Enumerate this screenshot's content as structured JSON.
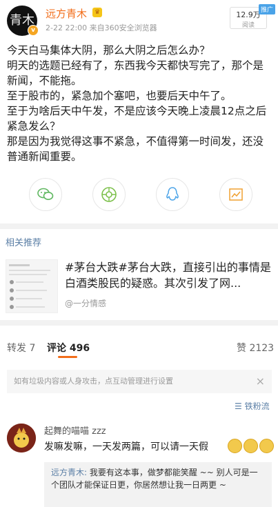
{
  "header": {
    "username": "远方青木",
    "avatar_text": "青木",
    "meta": "2-22 22:00 来自360安全浏览器",
    "read_count": "12.9万",
    "read_label": "阅读",
    "promo_label": "推广"
  },
  "post": {
    "paragraphs": [
      "今天白马集体大阴，那么大阴之后怎么办？",
      "明天的选题已经有了，东西我今天都快写完了，那个是新闻，不能拖。",
      "至于股市的，紧急加个塞吧，也要后天中午了。",
      "至于为啥后天中午发，不是应该今天晚上凌晨12点之后紧急发么？",
      "那是因为我觉得这事不紧急，不值得第一时间发，还没普通新闻重要。"
    ]
  },
  "share": {
    "icons": [
      "wechat-icon",
      "moments-icon",
      "qq-icon",
      "chart-icon"
    ]
  },
  "related": {
    "title": "相关推荐",
    "text": "#茅台大跌#茅台大跌，直接引出的事情是白酒类股民的疑惑。其次引发了网...",
    "source": "@一分情感"
  },
  "tabs": {
    "repost": "转发 7",
    "comment": "评论 496",
    "like": "赞 2123"
  },
  "notice": {
    "text": "如有垃圾内容或人身攻击，点互动管理进行设置",
    "close": "×"
  },
  "fans_label": "铁粉流",
  "comment": {
    "name": "起舞的喵喵 zzz",
    "text": "发嘛发嘛，一天发两篇，可以请一天假",
    "reply_name": "远方青木:",
    "reply_text": " 我要有这本事，做梦都能笑醒 ~~ 别人可是一个团队才能保证日更，你居然想让我一日两更 ~"
  },
  "colors": {
    "accent": "#f26d1a",
    "link": "#5b7fa6"
  }
}
